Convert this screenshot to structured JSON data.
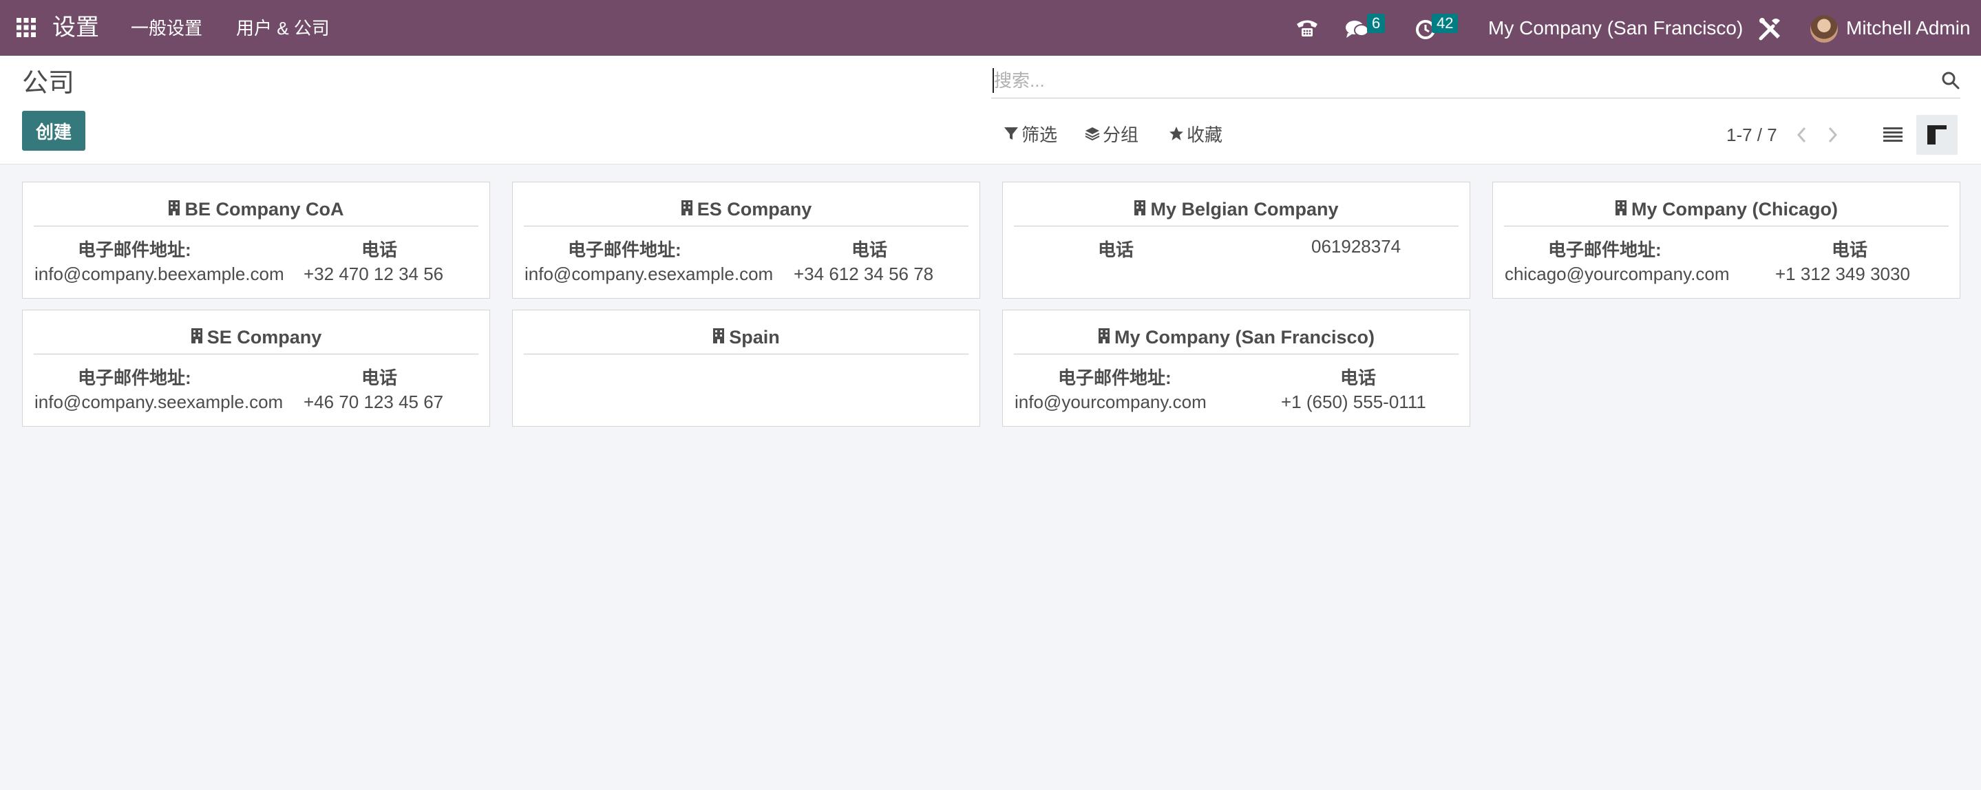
{
  "navbar": {
    "app_name": "设置",
    "menu": [
      "一般设置",
      "用户 & 公司"
    ],
    "messages_count": "6",
    "activities_count": "42",
    "company": "My Company (San Francisco)",
    "user": "Mitchell Admin",
    "brand_color": "#714b67"
  },
  "control_panel": {
    "title": "公司",
    "create_label": "创建",
    "search_placeholder": "搜索...",
    "filters_label": "筛选",
    "groupby_label": "分组",
    "favorites_label": "收藏",
    "pager": "1-7 / 7"
  },
  "labels": {
    "email": "电子邮件地址:",
    "phone": "电话"
  },
  "companies": [
    {
      "name": "BE Company CoA",
      "email": "info@company.beexample.com",
      "phone": "+32 470 12 34 56"
    },
    {
      "name": "ES Company",
      "email": "info@company.esexample.com",
      "phone": "+34 612 34 56 78"
    },
    {
      "name": "My Belgian Company",
      "email": "",
      "phone": "061928374"
    },
    {
      "name": "My Company (Chicago)",
      "email": "chicago@yourcompany.com",
      "phone": "+1 312 349 3030"
    },
    {
      "name": "SE Company",
      "email": "info@company.seexample.com",
      "phone": "+46 70 123 45 67"
    },
    {
      "name": "Spain",
      "email": "",
      "phone": ""
    },
    {
      "name": "My Company (San Francisco)",
      "email": "info@yourcompany.com",
      "phone": "+1 (650) 555-0111"
    }
  ]
}
